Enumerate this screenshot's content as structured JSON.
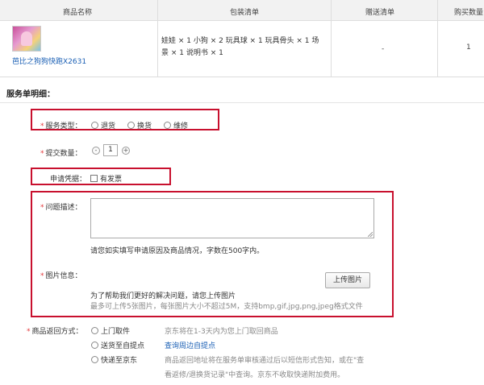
{
  "table": {
    "headers": [
      "商品名称",
      "包装清单",
      "赠送清单",
      "购买数量"
    ],
    "product_name": "芭比之狗狗快跑X2631",
    "package_list": "娃娃 × 1 小狗 × 2 玩具球 × 1 玩具骨头 × 1 场景 × 1 说明书 × 1",
    "gift": "-",
    "quantity": "1"
  },
  "section_title": "服务单明细：",
  "service_type": {
    "label": "服务类型：",
    "options": [
      "退货",
      "换货",
      "维修"
    ]
  },
  "submit_qty": {
    "label": "提交数量：",
    "minus": "-",
    "value": "1",
    "plus": "+"
  },
  "voucher": {
    "label": "申请凭据：",
    "option": "有发票"
  },
  "problem": {
    "label": "问题描述：",
    "hint": "请您如实填写申请原因及商品情况，字数在500字内。"
  },
  "image_info": {
    "label": "图片信息：",
    "upload_button": "上传图片",
    "hint1": "为了帮助我们更好的解决问题，请您上传图片",
    "hint2": "最多可上传5张图片，每张图片大小不超过5M，支持bmp,gif,jpg,png,jpeg格式文件"
  },
  "return_method": {
    "label": "商品返回方式：",
    "options": [
      "上门取件",
      "送货至自提点",
      "快递至京东"
    ],
    "desc1": "京东将在1-3天内为您上门取回商品",
    "desc2_link": "查询周边自提点",
    "desc3_line1": "商品返回地址将在服务单审核通过后以短信形式告知，或在\"查",
    "desc3_line2": "看返修/退换货记录\"中查询。京东不收取快递附加费用。"
  },
  "colors": {
    "highlight_box": "#c8102e",
    "link": "#1a5fb4",
    "required": "#e4393c"
  }
}
